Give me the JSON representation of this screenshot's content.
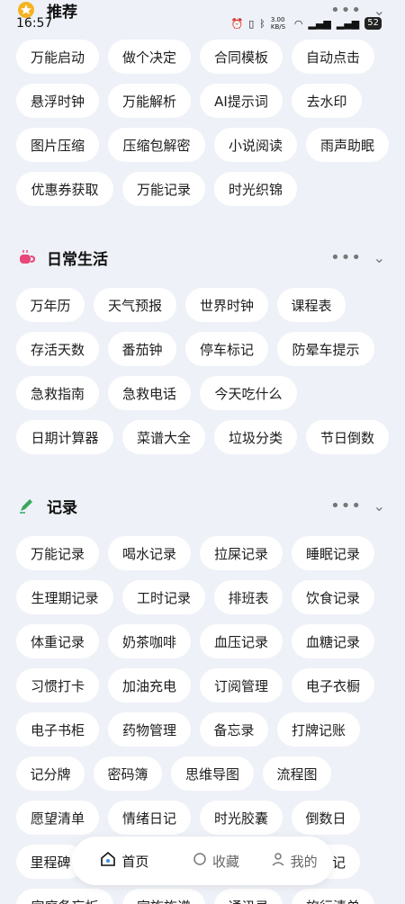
{
  "status": {
    "time": "16:57",
    "speed": "3.00 KB/S",
    "battery": "52"
  },
  "sections": {
    "recommend": {
      "title": "推荐",
      "rows": [
        [
          "万能启动",
          "做个决定",
          "合同模板",
          "自动点击"
        ],
        [
          "悬浮时钟",
          "万能解析",
          "AI提示词",
          "去水印"
        ],
        [
          "图片压缩",
          "压缩包解密",
          "小说阅读",
          "雨声助眠"
        ],
        [
          "优惠券获取",
          "万能记录",
          "时光织锦"
        ]
      ]
    },
    "daily": {
      "title": "日常生活",
      "rows": [
        [
          "万年历",
          "天气预报",
          "世界时钟",
          "课程表"
        ],
        [
          "存活天数",
          "番茄钟",
          "停车标记",
          "防晕车提示"
        ],
        [
          "急救指南",
          "急救电话",
          "今天吃什么"
        ],
        [
          "日期计算器",
          "菜谱大全",
          "垃圾分类",
          "节日倒数"
        ]
      ]
    },
    "record": {
      "title": "记录",
      "rows": [
        [
          "万能记录",
          "喝水记录",
          "拉屎记录",
          "睡眠记录"
        ],
        [
          "生理期记录",
          "工时记录",
          "排班表",
          "饮食记录"
        ],
        [
          "体重记录",
          "奶茶咖啡",
          "血压记录",
          "血糖记录"
        ],
        [
          "习惯打卡",
          "加油充电",
          "订阅管理",
          "电子衣橱"
        ],
        [
          "电子书柜",
          "药物管理",
          "备忘录",
          "打牌记账"
        ],
        [
          "记分牌",
          "密码簿",
          "思维导图",
          "流程图"
        ],
        [
          "愿望清单",
          "情绪日记",
          "时光胶囊",
          "倒数日"
        ],
        [
          "里程碑",
          "",
          "",
          "记"
        ],
        [
          "家庭备忘板",
          "家族族谱",
          "通讯录",
          "旅行清单"
        ]
      ]
    }
  },
  "nav": {
    "home": "首页",
    "favorites": "收藏",
    "mine": "我的"
  },
  "colors": {
    "background": "#eef1f7",
    "chip": "#ffffff",
    "accent_recommend": "#f5b321",
    "accent_daily": "#e8477a",
    "accent_record": "#3aa65c"
  }
}
